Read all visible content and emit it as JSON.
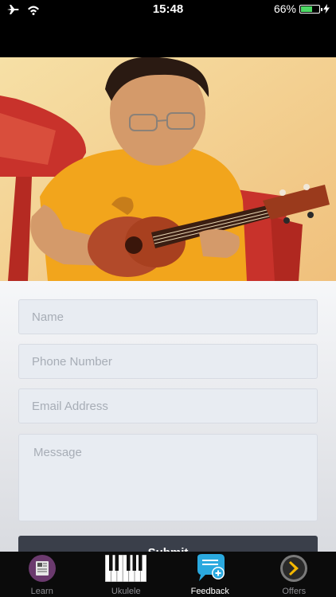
{
  "status_bar": {
    "time": "15:48",
    "battery_percent": "66%",
    "battery_level": 0.66
  },
  "form": {
    "name_placeholder": "Name",
    "phone_placeholder": "Phone Number",
    "email_placeholder": "Email Address",
    "message_placeholder": "Message",
    "submit_label": "Submit"
  },
  "tab_bar": {
    "tabs": [
      {
        "label": "Learn",
        "icon": "learn-icon"
      },
      {
        "label": "Ukulele",
        "icon": "piano-keys-icon"
      },
      {
        "label": "Feedback",
        "icon": "feedback-icon",
        "active": true
      },
      {
        "label": "Offers",
        "icon": "offers-icon"
      }
    ]
  }
}
